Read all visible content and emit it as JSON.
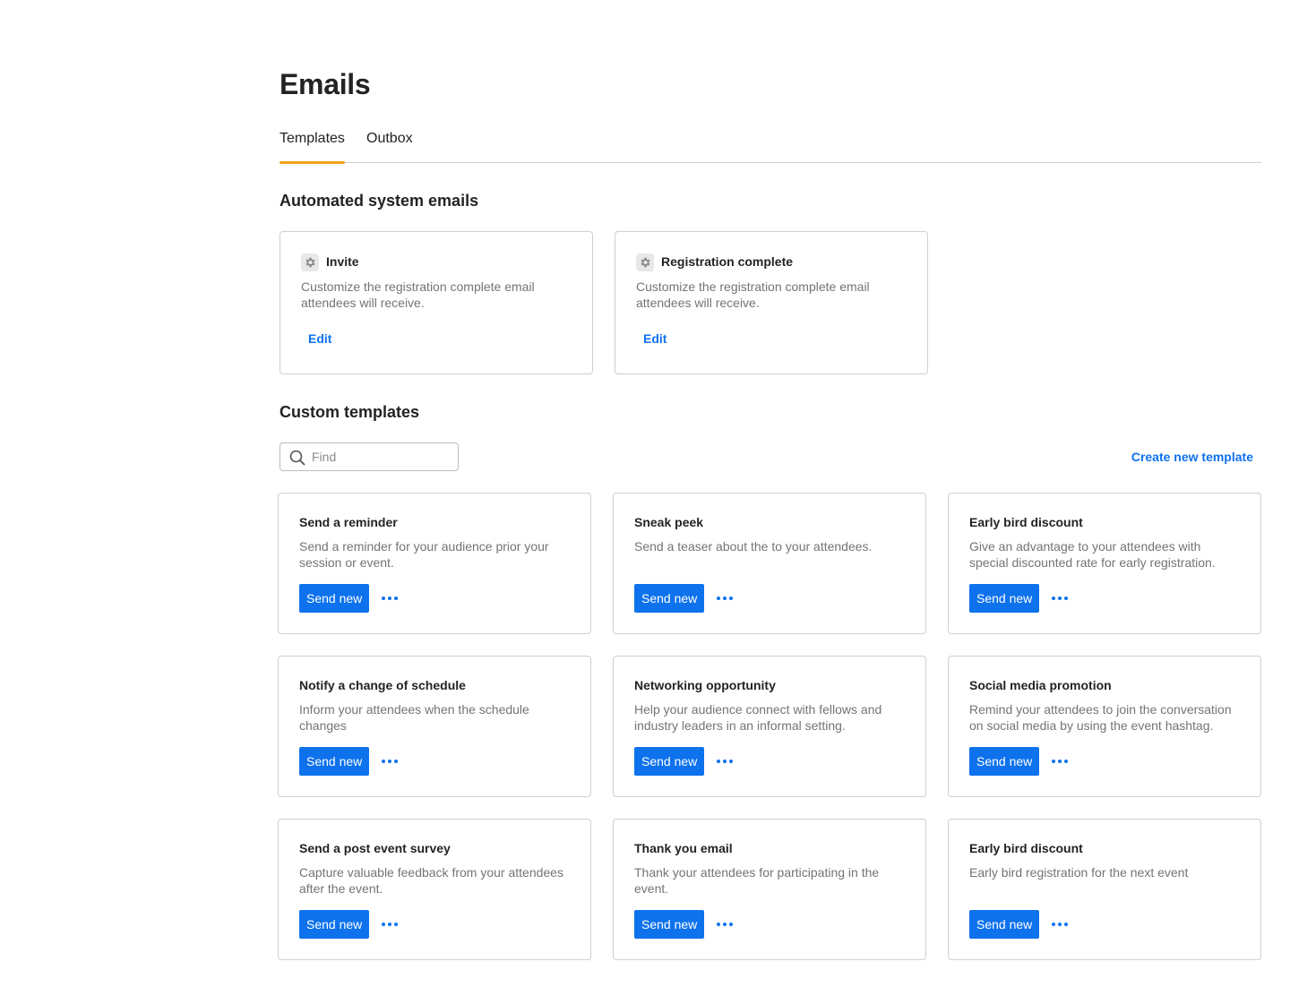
{
  "page": {
    "title": "Emails"
  },
  "tabs": [
    {
      "label": "Templates",
      "active": true
    },
    {
      "label": "Outbox",
      "active": false
    }
  ],
  "system": {
    "title": "Automated system emails",
    "cards": [
      {
        "title": "Invite",
        "icon": "gear-icon",
        "desc": "Customize the registration complete email attendees will receive.",
        "action": "Edit"
      },
      {
        "title": "Registration complete",
        "icon": "gear-icon",
        "desc": "Customize the registration complete email attendees will receive.",
        "action": "Edit"
      }
    ]
  },
  "custom": {
    "title": "Custom templates",
    "search": {
      "placeholder": "Find",
      "value": ""
    },
    "create_label": "Create new template",
    "send_label": "Send new",
    "cards": [
      {
        "title": "Send a reminder",
        "desc": "Send a reminder for your audience prior your session or event."
      },
      {
        "title": "Sneak peek",
        "desc": "Send a teaser about the to your attendees."
      },
      {
        "title": "Early bird discount",
        "desc": "Give an advantage to your attendees with special discounted rate for early registration."
      },
      {
        "title": "Notify a change of schedule",
        "desc": "Inform your attendees when the schedule changes"
      },
      {
        "title": "Networking opportunity",
        "desc": "Help your audience connect with fellows and industry leaders in an informal setting."
      },
      {
        "title": "Social media promotion",
        "desc": "Remind your attendees to join the conversation on social media by using the event hashtag."
      },
      {
        "title": "Send a post event survey",
        "desc": "Capture valuable feedback from your attendees after the event."
      },
      {
        "title": "Thank you email",
        "desc": "Thank your attendees for participating in the event."
      },
      {
        "title": "Early bird discount",
        "desc": "Early bird registration for the next event"
      }
    ]
  },
  "colors": {
    "accent": "#0e72ed",
    "tab_indicator": "#f3a21b",
    "border": "#cfcfcf",
    "muted_text": "#747474"
  }
}
